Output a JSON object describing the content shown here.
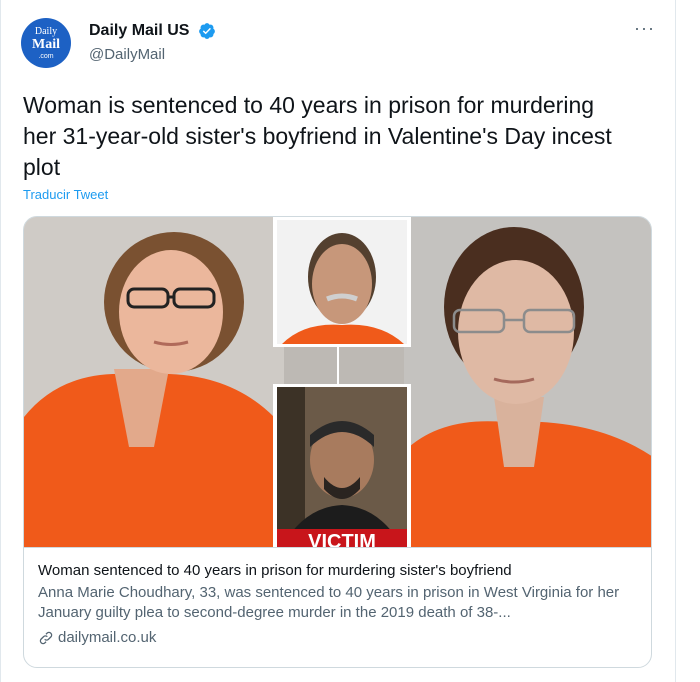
{
  "account": {
    "name": "Daily Mail US",
    "handle": "@DailyMail",
    "avatar_line1": "Daily",
    "avatar_line2": "Mail",
    "avatar_line3": ".com"
  },
  "tweet": {
    "text": "Woman is sentenced to 40 years in prison for murdering her 31-year-old sister's boyfriend in Valentine's Day incest plot",
    "translate_label": "Traducir Tweet",
    "more_icon": "more-dots-icon"
  },
  "card": {
    "image_caption": "VICTIM",
    "title": "Woman sentenced to 40 years in prison for murdering sister's boyfriend",
    "description": "Anna Marie Choudhary, 33, was sentenced to 40 years in prison in West Virginia for her January guilty plea to second-degree murder in the 2019 death of 38-...",
    "domain": "dailymail.co.uk"
  },
  "colors": {
    "accent": "#1d9bf0",
    "verified": "#1d9bf0",
    "avatar_bg": "#1d61c4",
    "jumpsuit": "#f05a1a"
  }
}
